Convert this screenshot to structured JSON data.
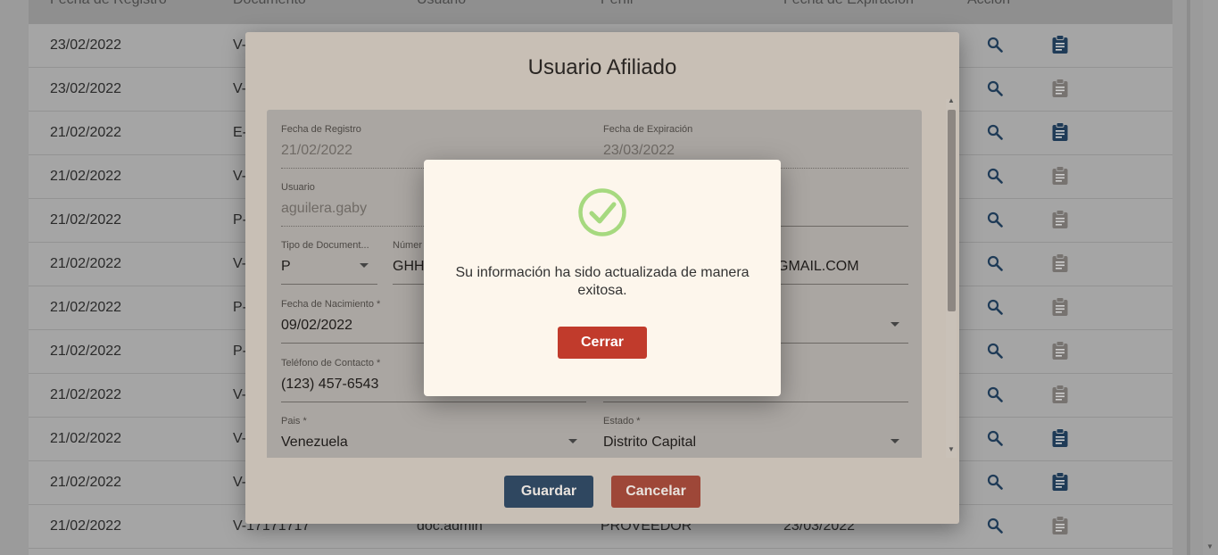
{
  "table": {
    "headers": [
      "Fecha de Registro",
      "Documento",
      "Usuario",
      "Perfil",
      "Fecha de Expiración",
      "Acción"
    ],
    "rows": [
      {
        "fecha": "23/02/2022",
        "doc": "V-"
      },
      {
        "fecha": "23/02/2022",
        "doc": "V-"
      },
      {
        "fecha": "21/02/2022",
        "doc": "E-"
      },
      {
        "fecha": "21/02/2022",
        "doc": "V-"
      },
      {
        "fecha": "21/02/2022",
        "doc": "P-"
      },
      {
        "fecha": "21/02/2022",
        "doc": "V-"
      },
      {
        "fecha": "21/02/2022",
        "doc": "P-"
      },
      {
        "fecha": "21/02/2022",
        "doc": "P-"
      },
      {
        "fecha": "21/02/2022",
        "doc": "V-"
      },
      {
        "fecha": "21/02/2022",
        "doc": "V-"
      },
      {
        "fecha": "21/02/2022",
        "doc": "V-"
      },
      {
        "fecha": "21/02/2022",
        "doc": "V-17171717",
        "usuario": "doc.admin",
        "perfil": "PROVEEDOR",
        "expira": "23/03/2022"
      }
    ],
    "clipboard_active": [
      true,
      false,
      true,
      false,
      false,
      false,
      false,
      false,
      false,
      true,
      true,
      false
    ]
  },
  "dialog": {
    "title": "Usuario Afiliado",
    "fields": {
      "fecha_registro": {
        "label": "Fecha de Registro",
        "value": "21/02/2022"
      },
      "fecha_expiracion": {
        "label": "Fecha de Expiración",
        "value": "23/03/2022"
      },
      "usuario": {
        "label": "Usuario",
        "value": "aguilera.gaby"
      },
      "tipo_documento": {
        "label": "Tipo de Document...",
        "value": "P"
      },
      "numero": {
        "label": "Númer",
        "value": "GHH"
      },
      "correo": {
        "value": "GMAIL.COM"
      },
      "fecha_nacimiento": {
        "label": "Fecha de Nacimiento *",
        "value": "09/02/2022"
      },
      "telefono": {
        "label": "Teléfono de Contacto *",
        "value": "(123) 457-6543"
      },
      "pais": {
        "label": "Pais *",
        "value": "Venezuela"
      },
      "estado": {
        "label": "Estado *",
        "value": "Distrito Capital"
      }
    },
    "save_label": "Guardar",
    "cancel_label": "Cancelar"
  },
  "alert": {
    "message": "Su información ha sido actualizada de manera exitosa.",
    "close_label": "Cerrar",
    "icon": "check-circle-icon",
    "success_color": "#a6d97f"
  },
  "colors": {
    "primary_button": "#2f4760",
    "danger_button": "#c13b2c",
    "icon_active": "#1f3b57"
  }
}
